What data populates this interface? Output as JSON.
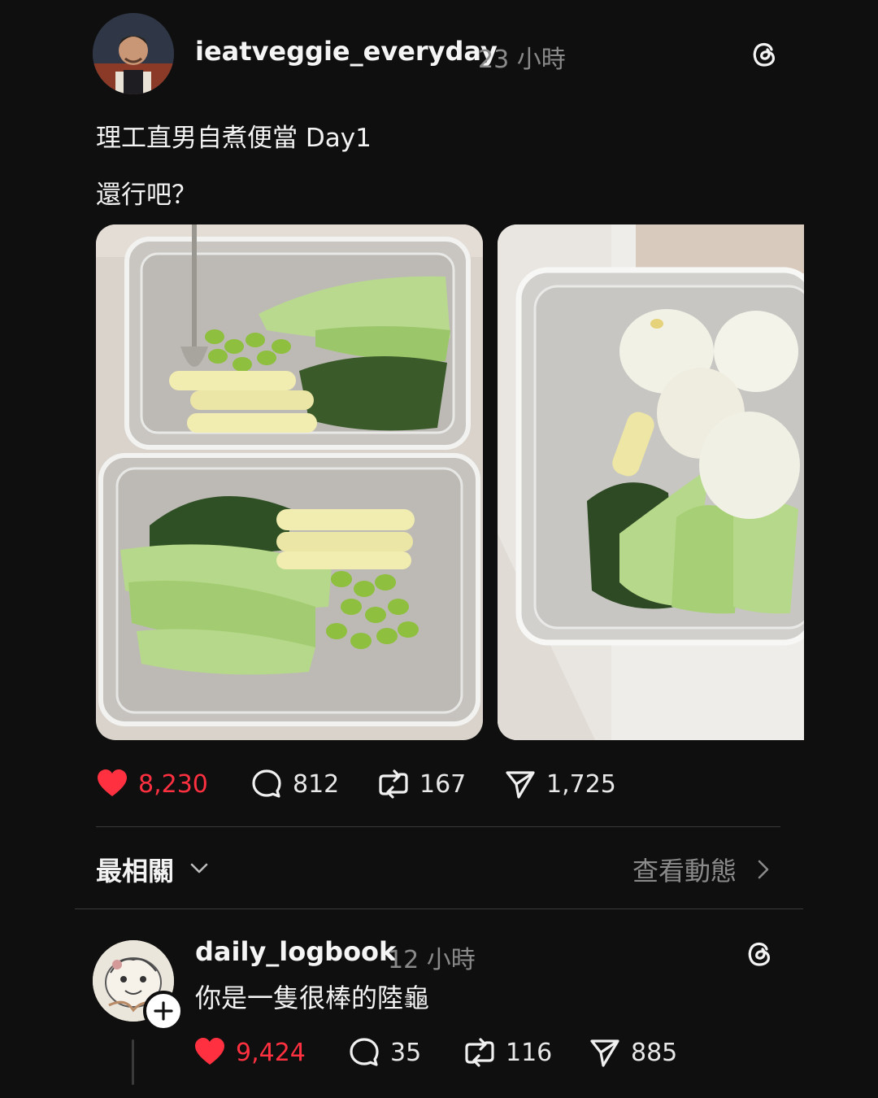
{
  "post": {
    "username": "ieatveggie_everyday",
    "timestamp": "23 小時",
    "text_line1": "理工直男自煮便當 Day1",
    "text_line2": "還行吧？",
    "likes": "8,230",
    "replies": "812",
    "reposts": "167",
    "shares": "1,725",
    "avatar_icon": "anime-character-avatar",
    "menu_icon": "threads-logo-icon",
    "liked": true
  },
  "sort": {
    "label": "最相關",
    "activity_link": "查看動態"
  },
  "comment": {
    "username": "daily_logbook",
    "timestamp": "12 小時",
    "text": "你是一隻很棒的陸龜",
    "likes": "9,424",
    "replies": "35",
    "reposts": "116",
    "shares": "885",
    "avatar_icon": "cartoon-sketch-avatar",
    "follow_icon": "plus-icon",
    "liked": true
  },
  "colors": {
    "background": "#0f0f0f",
    "like_red": "#ff3040",
    "secondary_text": "#8a8a8a",
    "divider": "#3a3a3a"
  }
}
